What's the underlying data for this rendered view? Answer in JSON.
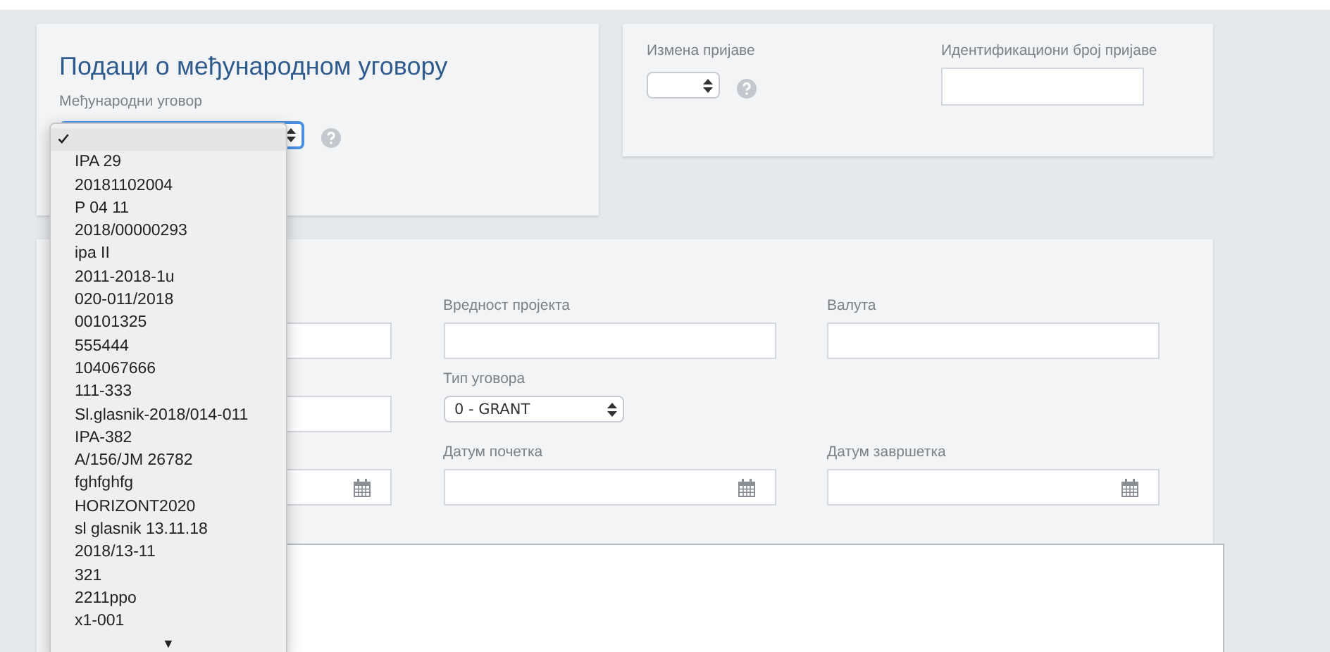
{
  "contract_card": {
    "title": "Подаци о међународном уговору",
    "field_label": "Међународни уговор"
  },
  "application_card": {
    "change_label": "Измена пријаве",
    "id_label": "Идентификациони број пријаве"
  },
  "project_card": {
    "rows": [
      {
        "kind": "inputs",
        "fields": [
          {
            "label": "Вредност пројекта"
          },
          {
            "label": "Валута"
          }
        ]
      },
      {
        "kind": "select",
        "fields": [
          {
            "label": "Тип уговора",
            "value": "0 - GRANT"
          }
        ]
      },
      {
        "kind": "dates",
        "fields": [
          {
            "label": "Датум почетка"
          },
          {
            "label": "Датум завршетка"
          }
        ]
      }
    ]
  },
  "dropdown": {
    "options": [
      {
        "selected": true
      },
      {
        "label": "IPA 29",
        "selected": false
      },
      {
        "label": "20181102004",
        "selected": false
      },
      {
        "label": "P 04 11",
        "selected": false
      },
      {
        "label": "2018/00000293",
        "selected": false
      },
      {
        "label": "ipa II",
        "selected": false
      },
      {
        "label": "2011-2018-1u",
        "selected": false
      },
      {
        "label": "020-011/2018",
        "selected": false
      },
      {
        "label": "00101325",
        "selected": false
      },
      {
        "label": "555444",
        "selected": false
      },
      {
        "label": "104067666",
        "selected": false
      },
      {
        "label": "111-333",
        "selected": false
      },
      {
        "label": "Sl.glasnik-2018/014-011",
        "selected": false
      },
      {
        "label": "IPA-382",
        "selected": false
      },
      {
        "label": "A/156/JM 26782",
        "selected": false
      },
      {
        "label": "fghfghfg",
        "selected": false
      },
      {
        "label": "HORIZONT2020",
        "selected": false
      },
      {
        "label": "sl glasnik 13.11.18",
        "selected": false
      },
      {
        "label": "2018/13-11",
        "selected": false
      },
      {
        "label": "321",
        "selected": false
      },
      {
        "label": "2211ppo",
        "selected": false
      },
      {
        "label": "x1-001",
        "selected": false
      }
    ],
    "scroll_arrow": "▼"
  }
}
